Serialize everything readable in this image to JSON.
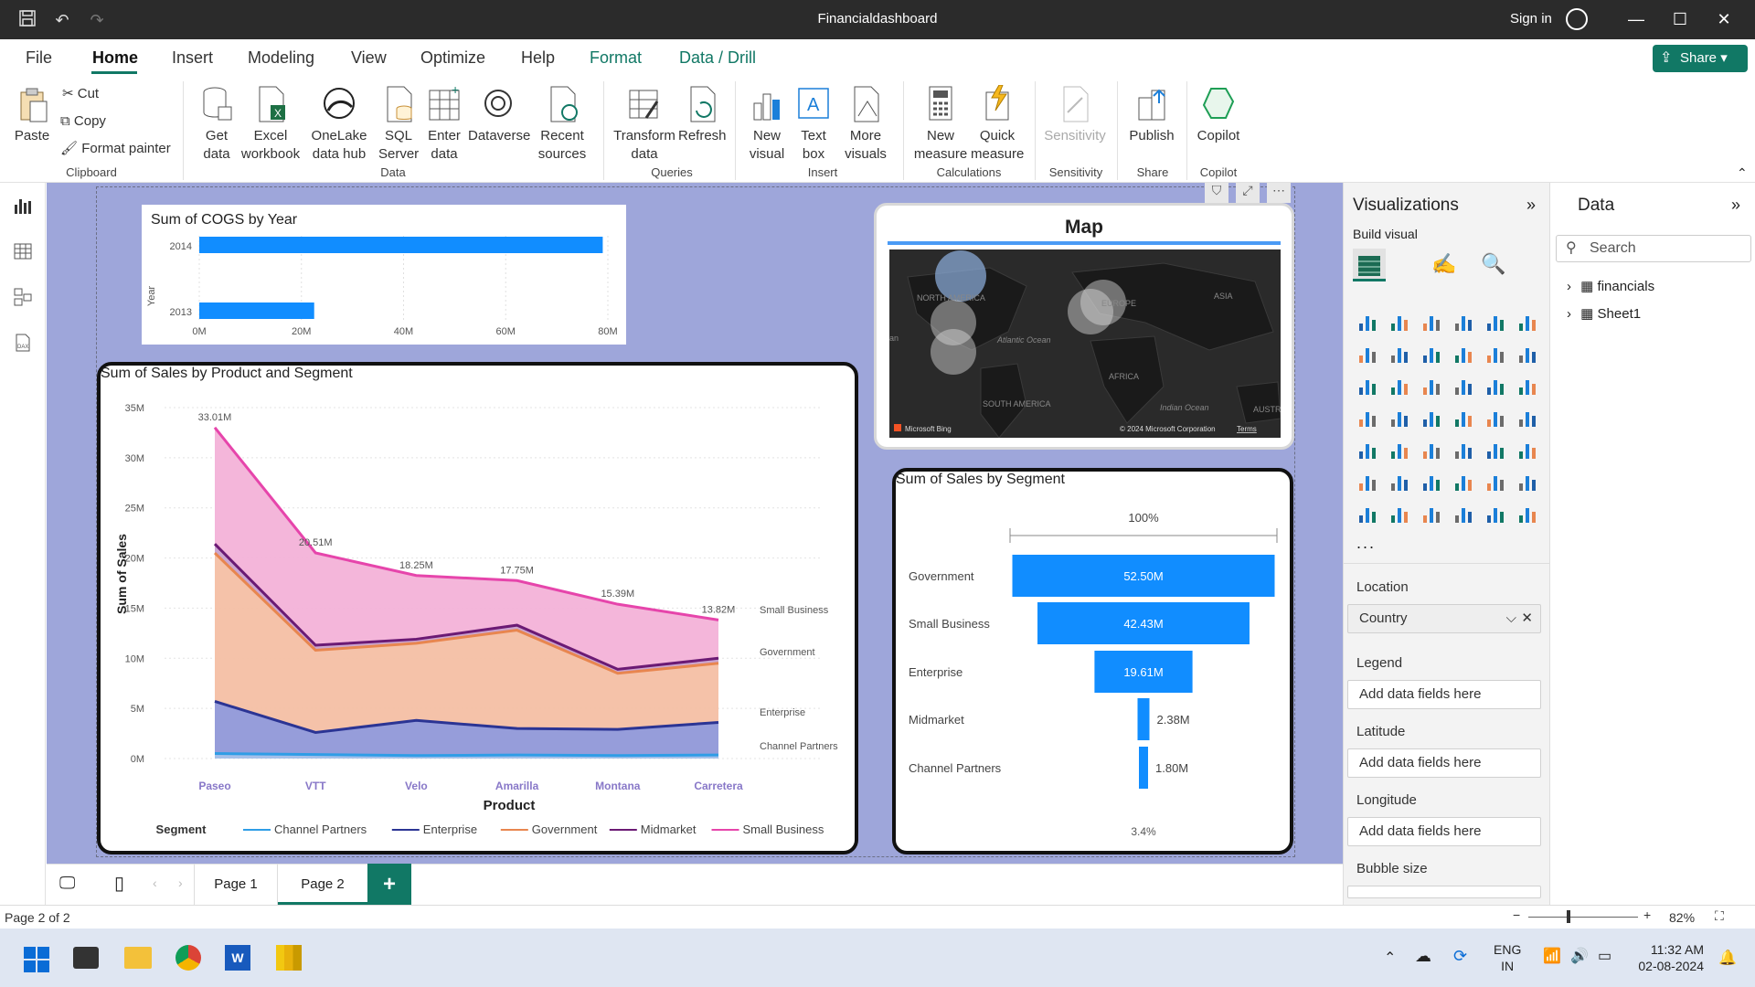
{
  "window": {
    "title": "Financialdashboard",
    "signin": "Sign in"
  },
  "menu": {
    "items": [
      "File",
      "Home",
      "Insert",
      "Modeling",
      "View",
      "Optimize",
      "Help",
      "Format",
      "Data / Drill"
    ],
    "share": "Share"
  },
  "ribbon": {
    "clipboard": {
      "paste": "Paste",
      "cut": "Cut",
      "copy": "Copy",
      "format_painter": "Format painter",
      "group": "Clipboard"
    },
    "data": {
      "get_data": "Get data",
      "excel": "Excel workbook",
      "onelake": "OneLake data hub",
      "sql": "SQL Server",
      "enter": "Enter data",
      "dataverse": "Dataverse",
      "recent": "Recent sources",
      "group": "Data"
    },
    "queries": {
      "transform": "Transform data",
      "refresh": "Refresh",
      "group": "Queries"
    },
    "insert": {
      "new_visual": "New visual",
      "text_box": "Text box",
      "more_visuals": "More visuals",
      "group": "Insert"
    },
    "calculations": {
      "new_measure": "New measure",
      "quick_measure": "Quick measure",
      "group": "Calculations"
    },
    "sensitivity": {
      "label": "Sensitivity",
      "group": "Sensitivity"
    },
    "share": {
      "publish": "Publish",
      "group": "Share"
    },
    "copilot": {
      "label": "Copilot",
      "group": "Copilot"
    }
  },
  "cogs_chart": {
    "title": "Sum of COGS by Year",
    "ylabel": "Year",
    "categories": [
      "2014",
      "2013"
    ],
    "values": [
      79000000,
      22500000
    ],
    "ticks": [
      "0M",
      "20M",
      "40M",
      "60M",
      "80M"
    ]
  },
  "map": {
    "title": "Map",
    "labels": [
      "NORTH AMERICA",
      "EUROPE",
      "ASIA",
      "Atlantic Ocean",
      "AFRICA",
      "SOUTH AMERICA",
      "Indian Ocean",
      "AUSTR",
      "an"
    ],
    "footer_left": "Microsoft Bing",
    "footer_right": "© 2024 Microsoft Corporation",
    "terms": "Terms"
  },
  "chart_data": [
    {
      "type": "area",
      "title": "Sum of Sales by Product and Segment",
      "xlabel": "Product",
      "ylabel": "Sum of Sales",
      "categories": [
        "Paseo",
        "VTT",
        "Velo",
        "Amarilla",
        "Montana",
        "Carretera"
      ],
      "yticks": [
        "0M",
        "5M",
        "10M",
        "15M",
        "20M",
        "25M",
        "30M",
        "35M"
      ],
      "ylim": [
        0,
        35
      ],
      "legend_title": "Segment",
      "series": [
        {
          "name": "Channel Partners",
          "values": [
            0.5,
            0.4,
            0.3,
            0.35,
            0.3,
            0.35
          ],
          "color": "#2f9de6"
        },
        {
          "name": "Enterprise",
          "values": [
            5.7,
            2.6,
            3.8,
            3.0,
            2.9,
            3.6
          ],
          "color": "#2b3494"
        },
        {
          "name": "Government",
          "values": [
            20.5,
            10.8,
            11.5,
            12.8,
            8.5,
            9.5
          ],
          "color": "#e8864f"
        },
        {
          "name": "Midmarket",
          "values": [
            21.4,
            11.3,
            11.9,
            13.3,
            8.9,
            10.0
          ],
          "color": "#6b1a74"
        },
        {
          "name": "Small Business",
          "values": [
            33.01,
            20.51,
            18.25,
            17.75,
            15.39,
            13.82
          ],
          "color": "#e645ab"
        }
      ],
      "top_labels": [
        "33.01M",
        "20.51M",
        "18.25M",
        "17.75M",
        "15.39M",
        "13.82M"
      ],
      "end_labels": [
        "Small Business",
        "Government",
        "Enterprise",
        "Channel Partners"
      ]
    },
    {
      "type": "bar",
      "title": "Sum of Sales by Segment",
      "top_label": "100%",
      "categories": [
        "Government",
        "Small Business",
        "Enterprise",
        "Midmarket",
        "Channel Partners"
      ],
      "values": [
        52.5,
        42.43,
        19.61,
        2.38,
        1.8
      ],
      "labels": [
        "52.50M",
        "42.43M",
        "19.61M",
        "2.38M",
        "1.80M"
      ],
      "bottom_label": "3.4%"
    }
  ],
  "visualizations": {
    "title": "Visualizations",
    "build": "Build visual",
    "more": "...",
    "wells": [
      {
        "label": "Location",
        "value": "Country"
      },
      {
        "label": "Legend",
        "value": "Add data fields here"
      },
      {
        "label": "Latitude",
        "value": "Add data fields here"
      },
      {
        "label": "Longitude",
        "value": "Add data fields here"
      },
      {
        "label": "Bubble size",
        "value": ""
      }
    ]
  },
  "data_pane": {
    "title": "Data",
    "search": "Search",
    "tables": [
      "financials",
      "Sheet1"
    ]
  },
  "pages": {
    "tabs": [
      "Page 1",
      "Page 2"
    ],
    "active": "Page 2",
    "add": "+"
  },
  "status": {
    "page": "Page 2 of 2",
    "zoom": "82%"
  },
  "taskbar": {
    "lang1": "ENG",
    "lang2": "IN",
    "time": "11:32 AM",
    "date": "02-08-2024"
  }
}
